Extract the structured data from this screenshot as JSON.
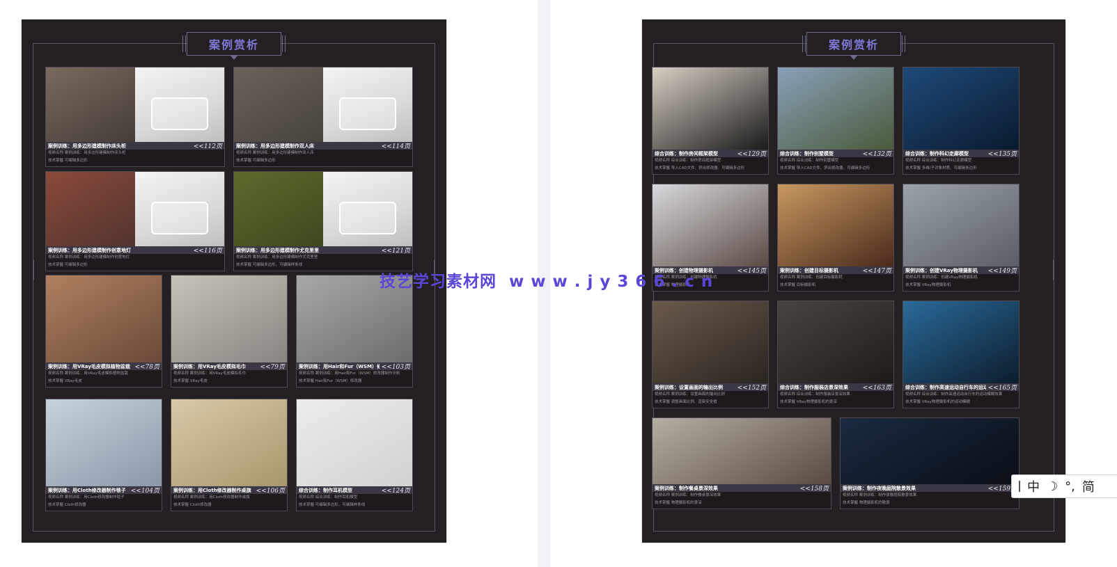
{
  "left_page": {
    "heading": "案例赏析",
    "cards": [
      {
        "title": "案例训练：用多边形建模制作床头柜",
        "page": "<<112页",
        "line1": "视频名称  案例训练：用多边形建模制作床头柜",
        "line2": "技术掌握  可编辑多边形",
        "colors": [
          "#7a6a5e",
          "#2e2a28"
        ]
      },
      {
        "title": "案例训练：用多边形建模制作双人床",
        "page": "<<114页",
        "line1": "视频名称  案例训练：用多边形建模制作双人床",
        "line2": "技术掌握  可编辑多边形",
        "colors": [
          "#6b625a",
          "#3a3632"
        ]
      },
      {
        "title": "案例训练：用多边形建模制作创意地灯",
        "page": "<<116页",
        "line1": "视频名称  案例训练：用多边形建模制作创意地灯",
        "line2": "技术掌握  可编辑多边形",
        "colors": [
          "#8a4a3a",
          "#3b2a2a"
        ]
      },
      {
        "title": "案例训练：用多边形建模制作尤克里里",
        "page": "<<121页",
        "line1": "视频名称  案例训练：用多边形建模制作尤克里里",
        "line2": "技术掌握  可编辑多边形、可编辑样条线",
        "colors": [
          "#5c6b2c",
          "#2f3a1a"
        ]
      },
      {
        "title": "案例训练：用VRay毛皮模拟植物盆栽",
        "page": "<<78页",
        "line1": "视频名称  案例训练：用VRay毛皮模拟植物盆栽",
        "line2": "技术掌握  VRay毛皮",
        "colors": [
          "#b08060",
          "#6a4a38"
        ]
      },
      {
        "title": "案例训练：用VRay毛皮模拟毛巾",
        "page": "<<79页",
        "line1": "视频名称  案例训练：用VRay毛皮模拟毛巾",
        "line2": "技术掌握  VRay毛皮",
        "colors": [
          "#c8c2bc",
          "#8a8480"
        ]
      },
      {
        "title": "案例训练：用Hair和Fur（WSM）修改器制作牙刷",
        "page": "<<103页",
        "line1": "视频名称  案例训练：用Hair和Fur（WSM）修改器制作牙刷",
        "line2": "技术掌握  Hair和Fur（WSM）修改器",
        "colors": [
          "#a8a8a8",
          "#6c6c6c"
        ]
      },
      {
        "title": "案例训练：用Cloth修改器制作毯子",
        "page": "<<104页",
        "line1": "视频名称  案例训练：用Cloth修改器制作毯子",
        "line2": "技术掌握  Cloth修改器",
        "colors": [
          "#c8d2dc",
          "#8a98a6"
        ]
      },
      {
        "title": "案例训练：用Cloth修改器制作桌旗",
        "page": "<<106页",
        "line1": "视频名称  案例训练：用Cloth修改器制作桌旗",
        "line2": "技术掌握  Cloth修改器",
        "colors": [
          "#d8c9a8",
          "#a8966c"
        ]
      },
      {
        "title": "综合训练：制作耳机模型",
        "page": "<<124页",
        "line1": "视频名称  综合训练：制作耳机模型",
        "line2": "技术掌握  可编辑多边形、可编辑样条线",
        "colors": [
          "#ececec",
          "#d2d2d2"
        ]
      }
    ]
  },
  "right_page": {
    "heading": "案例赏析",
    "cards": [
      {
        "title": "综合训练：制作房间框架模型",
        "page": "<<129页",
        "line1": "视频名称  综合训练：制作房间框架模型",
        "line2": "技术掌握  导入CAD文件、挤出修改器、可编辑多边形",
        "colors": [
          "#d8cfc4",
          "#1a1a1a"
        ]
      },
      {
        "title": "综合训练：制作别墅模型",
        "page": "<<132页",
        "line1": "视频名称  综合训练：制作别墅模型",
        "line2": "技术掌握  导入CAD文件、挤出修改器、可编辑多边形",
        "colors": [
          "#8aa0b8",
          "#4a5a3a"
        ]
      },
      {
        "title": "综合训练：制作科幻走廊模型",
        "page": "<<135页",
        "line1": "视频名称  综合训练：制作科幻走廊模型",
        "line2": "技术掌握  多维/子对象材质、可编辑多边形",
        "colors": [
          "#1e4a7a",
          "#0a1a2e"
        ]
      },
      {
        "title": "案例训练：创建物理摄影机",
        "page": "<<145页",
        "line1": "视频名称  案例训练：创建物理摄影机",
        "line2": "技术掌握  物理摄影机",
        "colors": [
          "#d8d8dc",
          "#5a4a44"
        ]
      },
      {
        "title": "案例训练：创建目标摄影机",
        "page": "<<147页",
        "line1": "视频名称  案例训练：创建目标摄影机",
        "line2": "技术掌握  目标摄影机",
        "colors": [
          "#c89860",
          "#4a2a1c"
        ]
      },
      {
        "title": "案例训练：创建VRay物理摄影机",
        "page": "<<149页",
        "line1": "视频名称  案例训练：创建VRay物理摄影机",
        "line2": "技术掌握  VRay物理摄影机",
        "colors": [
          "#9aa2aa",
          "#5a5e64"
        ]
      },
      {
        "title": "案例训练：设置画面的输出比例",
        "page": "<<152页",
        "line1": "视频名称  案例训练：设置画面的输出比例",
        "line2": "技术掌握  调整画面比例、渲染安全框",
        "colors": [
          "#6a5a4c",
          "#2a2420"
        ]
      },
      {
        "title": "综合训练：制作服装店景深效果",
        "page": "<<163页",
        "line1": "视频名称  综合训练：制作服装店景深效果",
        "line2": "技术掌握  VRay物理摄影机的景深",
        "colors": [
          "#4a4440",
          "#1c1a18"
        ]
      },
      {
        "title": "综合训练：制作高速运动自行车的运动模糊效果",
        "page": "<<165页",
        "line1": "视频名称  综合训练：制作高速运动自行车的运动模糊效果",
        "line2": "技术掌握  VRay物理摄影机的运动模糊",
        "colors": [
          "#2a6a9a",
          "#0c1c2c"
        ]
      },
      {
        "title": "案例训练：制作餐桌景深效果",
        "page": "<<158页",
        "line1": "视频名称  案例训练：制作餐桌景深效果",
        "line2": "技术掌握  物理摄影机的景深",
        "colors": [
          "#b4aea4",
          "#5a4a40"
        ]
      },
      {
        "title": "案例训练：制作夜晚庭院散景效果",
        "page": "<<159页",
        "line1": "视频名称  案例训练：制作夜晚庭院散景效果",
        "line2": "技术掌握  物理摄影机的散景",
        "colors": [
          "#1a2a40",
          "#0a0e16"
        ]
      }
    ]
  },
  "watermark": "技艺学习素材网  w w w . j y 3 6 6 . c n",
  "ime": {
    "mode": "中",
    "moon": "☽",
    "punct": "°,",
    "script": "简"
  }
}
